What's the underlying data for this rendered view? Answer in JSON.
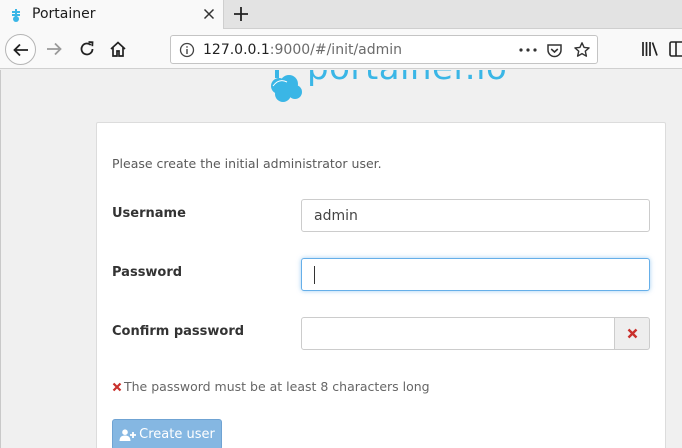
{
  "browser": {
    "tab_title": "Portainer",
    "url_host": "127.0.0.1",
    "url_rest": ":9000/#/init/admin"
  },
  "logo": {
    "text": "portainer.io",
    "color": "#3ab6e6"
  },
  "form": {
    "intro": "Please create the initial administrator user.",
    "username_label": "Username",
    "username_value": "admin",
    "password_label": "Password",
    "password_value": "",
    "confirm_label": "Confirm password",
    "confirm_value": "",
    "error_text": "The password must be at least 8 characters long",
    "submit_label": "Create user"
  },
  "colors": {
    "error_red": "#c9302c",
    "primary_disabled": "#85b7e2",
    "focus_blue": "#66afe9"
  },
  "icons": {
    "tab_favicon": "portainer-favicon-icon",
    "tab_close": "close-icon",
    "new_tab": "plus-icon",
    "back": "arrow-left-icon",
    "forward": "arrow-right-icon",
    "reload": "reload-icon",
    "home": "home-icon",
    "site_info": "info-icon",
    "page_actions": "more-icon",
    "pocket": "pocket-icon",
    "bookmark": "star-icon",
    "library": "library-icon",
    "confirm_invalid": "times-icon",
    "error": "times-icon",
    "create_user": "user-plus-icon"
  }
}
